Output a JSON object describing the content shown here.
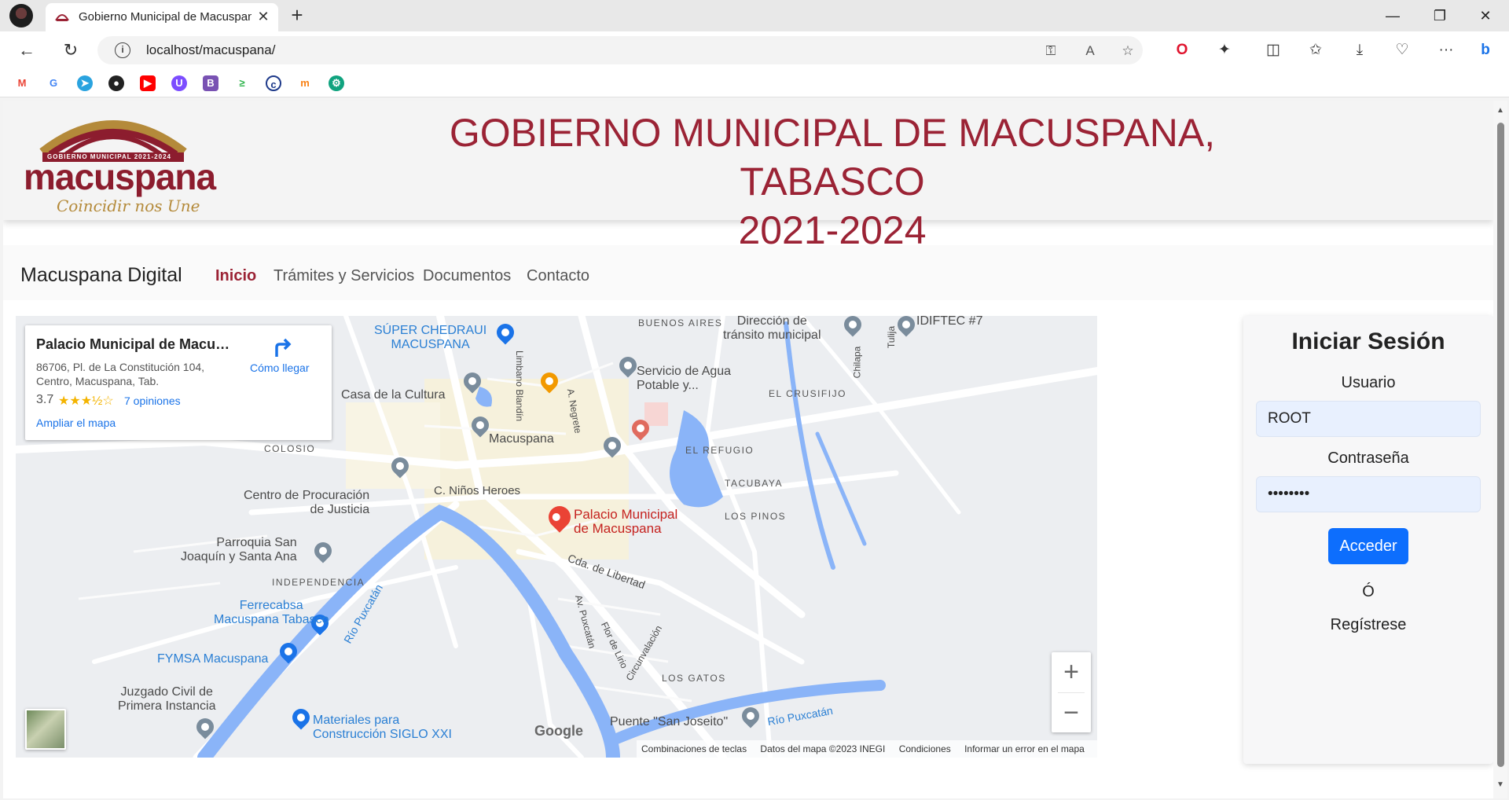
{
  "browser": {
    "tab_title": "Gobierno Municipal de Macuspana",
    "url": "localhost/macuspana/",
    "window_controls": [
      "minimize",
      "restore",
      "close"
    ],
    "bookmarks": [
      "gmail",
      "google",
      "telegram",
      "github",
      "youtube",
      "proton",
      "bootstrap",
      "terminal",
      "codepen",
      "moodle",
      "chatgpt"
    ]
  },
  "header": {
    "logo_text": "macuspana",
    "logo_ribbon": "GOBIERNO MUNICIPAL 2021-2024",
    "logo_tagline": "Coincidir nos Une",
    "title_line1": "GOBIERNO MUNICIPAL DE MACUSPANA, TABASCO",
    "title_line2": "2021-2024"
  },
  "nav": {
    "brand": "Macuspana Digital",
    "links": [
      "Inicio",
      "Trámites y Servicios",
      "Documentos",
      "Contacto"
    ],
    "active": "Inicio"
  },
  "map": {
    "card": {
      "title": "Palacio Municipal de Macusp...",
      "address": "86706, Pl. de La Constitución 104, Centro, Macuspana, Tab.",
      "rating": "3.7",
      "stars": "★★★½☆",
      "reviews": "7 opiniones",
      "directions": "Cómo llegar",
      "enlarge": "Ampliar el mapa"
    },
    "labels": {
      "super": "SÚPER CHEDRAUI\nMACUSPANA",
      "buenos_aires": "BUENOS AIRES",
      "transito": "Dirección de\ntránsito municipal",
      "idiftec": "IDIFTEC #7",
      "casa_cultura": "Casa de la Cultura",
      "servicio_agua": "Servicio de Agua\nPotable y...",
      "el_crusifijo": "EL CRUSIFIJO",
      "colosio": "COLOSIO",
      "macuspana": "Macuspana",
      "el_refugio": "EL REFUGIO",
      "tacubaya": "TACUBAYA",
      "procuracion": "Centro de Procuración\nde Justicia",
      "ninos_heroes": "C. Niños Heroes",
      "palacio": "Palacio Municipal\nde Macuspana",
      "los_pinos": "LOS PINOS",
      "parroquia": "Parroquia San\nJoaquín y Santa Ana",
      "independencia": "INDEPENDENCIA",
      "libertad": "Cda. de Libertad",
      "ferrecabsa": "Ferrecabsa\nMacuspana Tabasco",
      "rio_puxcatan": "Río Puxcatán",
      "fymsa": "FYMSA Macuspana",
      "juzgado": "Juzgado Civil de\nPrimera Instancia",
      "materiales": "Materiales para\nConstrucción SIGLO XXI",
      "los_gatos": "LOS GATOS",
      "puente": "Puente \"San Joseito\"",
      "rio_puxcatan2": "Río Puxcatán",
      "limbano": "Limbano Blandín",
      "negrete": "A. Negrete",
      "chilapa": "Chilapa",
      "tulija": "Tulija",
      "av_puxcatan": "Av. Puxcatán",
      "flor_lirio": "Flor de Lirio",
      "circunvalacion": "Circunvalación"
    },
    "google": "Google",
    "footer": [
      "Combinaciones de teclas",
      "Datos del mapa ©2023 INEGI",
      "Condiciones",
      "Informar un error en el mapa"
    ],
    "zoom_in": "+",
    "zoom_out": "−"
  },
  "login": {
    "title": "Iniciar Sesión",
    "user_label": "Usuario",
    "user_value": "ROOT",
    "pass_label": "Contraseña",
    "pass_value": "••••••••",
    "submit": "Acceder",
    "or": "Ó",
    "register": "Regístrese"
  },
  "colors": {
    "brand": "#9b2335",
    "primary_button": "#0d6efd"
  }
}
